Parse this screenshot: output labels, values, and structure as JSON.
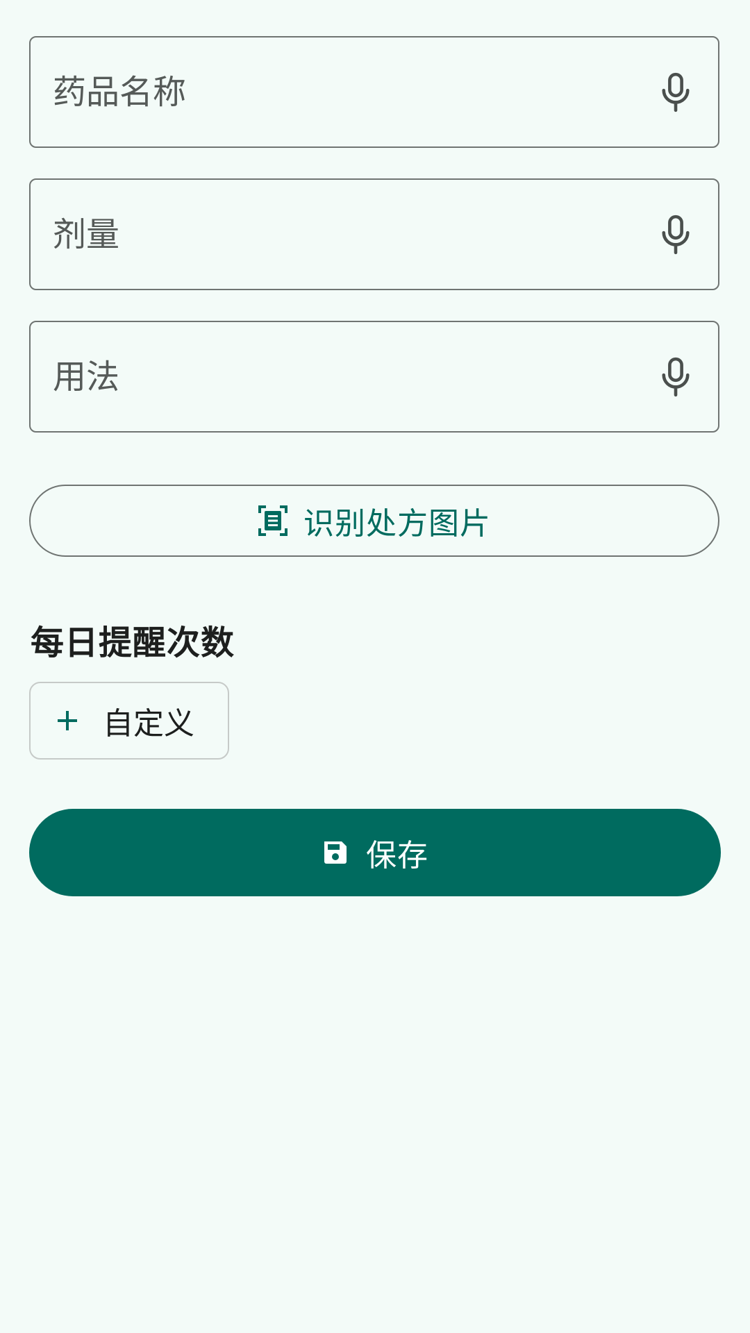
{
  "form": {
    "drug_name_placeholder": "药品名称",
    "dosage_placeholder": "剂量",
    "usage_placeholder": "用法",
    "voice_input_icon": "mic-icon"
  },
  "ocr_button": {
    "label": "识别处方图片",
    "icon": "document-scanner-icon"
  },
  "reminder": {
    "title": "每日提醒次数",
    "custom_chip_label": "自定义",
    "custom_chip_icon": "plus-icon"
  },
  "save_button": {
    "label": "保存",
    "icon": "save-icon"
  },
  "colors": {
    "background": "#f3fbf8",
    "primary": "#006b5f",
    "outline": "#6f7472",
    "chip_outline": "#c6cac8",
    "on_primary": "#ffffff"
  }
}
